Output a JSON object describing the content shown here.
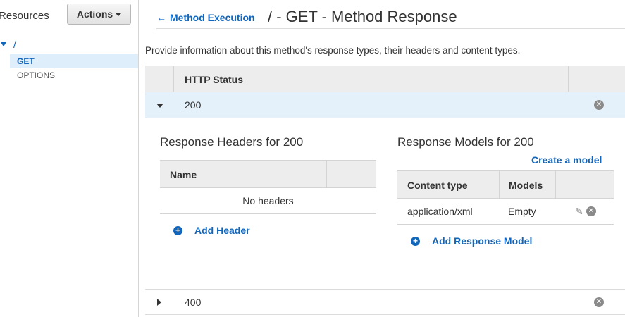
{
  "sidebar": {
    "title": "Resources",
    "actions_label": "Actions",
    "tree": {
      "root_label": "/",
      "items": [
        {
          "label": "GET",
          "selected": true
        },
        {
          "label": "OPTIONS",
          "selected": false
        }
      ]
    }
  },
  "header": {
    "back_link": "Method Execution",
    "title": "/ - GET - Method Response"
  },
  "description": "Provide information about this method's response types, their headers and content types.",
  "status_table": {
    "column_header": "HTTP Status",
    "rows": [
      {
        "status": "200",
        "expanded": true
      },
      {
        "status": "400",
        "expanded": false
      }
    ]
  },
  "response_headers": {
    "title": "Response Headers for 200",
    "column_name": "Name",
    "empty_text": "No headers",
    "add_label": "Add Header"
  },
  "response_models": {
    "title": "Response Models for 200",
    "create_link": "Create a model",
    "columns": [
      "Content type",
      "Models"
    ],
    "rows": [
      {
        "content_type": "application/xml",
        "model": "Empty"
      }
    ],
    "add_label": "Add Response Model"
  },
  "icons": {
    "back": "arrow-left-icon",
    "add": "plus-circle-icon",
    "remove": "remove-circle-icon",
    "edit": "pencil-icon"
  },
  "colors": {
    "link": "#1166bb",
    "selected_row_bg": "#e4f1fb",
    "header_bg": "#ededed"
  }
}
